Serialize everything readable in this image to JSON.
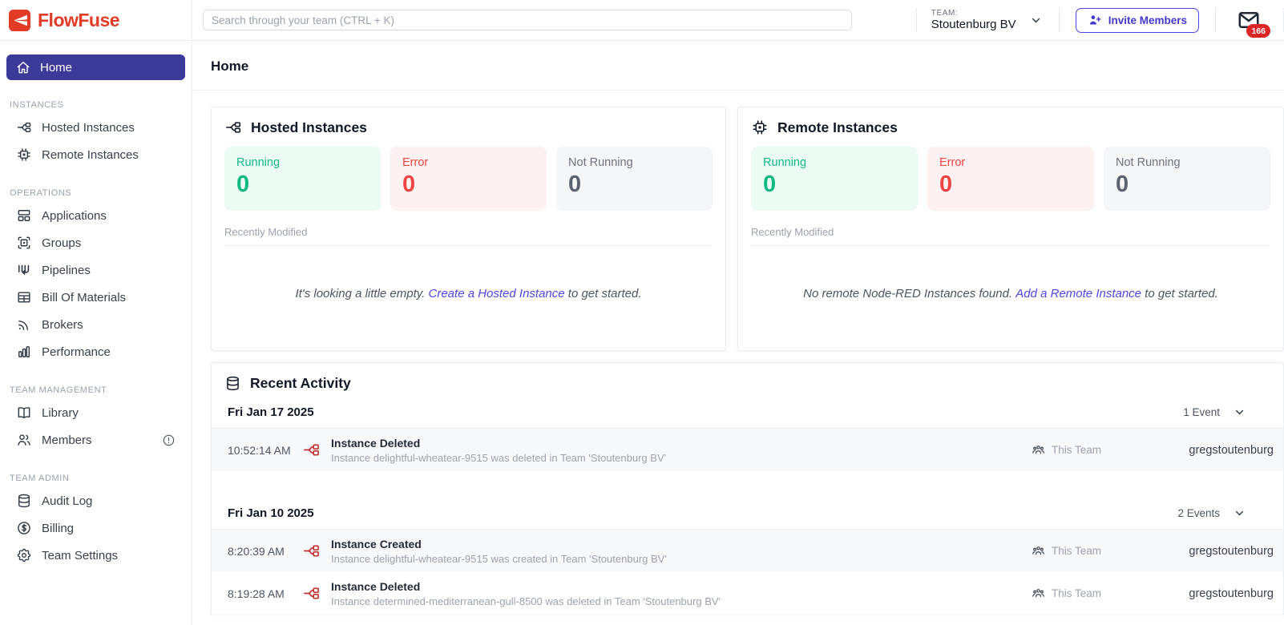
{
  "brand": {
    "name": "FlowFuse"
  },
  "colors": {
    "brand": "#E23C28",
    "accent": "#4F46E5",
    "nav_active_bg": "#3B3A9A",
    "badge_red": "#DC2626",
    "running_fg": "#10B981",
    "running_bg": "#ECFBF4",
    "error_fg": "#EF4444",
    "error_bg": "#FDF1F1",
    "neutral_fg": "#5A6372",
    "neutral_bg": "#F5F6F8"
  },
  "header": {
    "search_placeholder": "Search through your team (CTRL + K)",
    "team_label": "TEAM:",
    "team_name": "Stoutenburg BV",
    "invite_button": "Invite Members",
    "notification_count": "166"
  },
  "sidebar": {
    "home": {
      "label": "Home"
    },
    "sections": [
      {
        "title": "INSTANCES",
        "items": [
          {
            "label": "Hosted Instances"
          },
          {
            "label": "Remote Instances"
          }
        ]
      },
      {
        "title": "OPERATIONS",
        "items": [
          {
            "label": "Applications"
          },
          {
            "label": "Groups"
          },
          {
            "label": "Pipelines"
          },
          {
            "label": "Bill Of Materials"
          },
          {
            "label": "Brokers"
          },
          {
            "label": "Performance"
          }
        ]
      },
      {
        "title": "TEAM MANAGEMENT",
        "items": [
          {
            "label": "Library"
          },
          {
            "label": "Members",
            "alert": true
          }
        ]
      },
      {
        "title": "TEAM ADMIN",
        "items": [
          {
            "label": "Audit Log"
          },
          {
            "label": "Billing"
          },
          {
            "label": "Team Settings"
          }
        ]
      }
    ]
  },
  "page": {
    "title": "Home"
  },
  "cards": {
    "hosted": {
      "title": "Hosted Instances",
      "stats": [
        {
          "label": "Running",
          "value": "0"
        },
        {
          "label": "Error",
          "value": "0"
        },
        {
          "label": "Not Running",
          "value": "0"
        }
      ],
      "recently_modified": "Recently Modified",
      "empty_prefix": "It's looking a little empty. ",
      "empty_link": "Create a Hosted Instance",
      "empty_suffix": " to get started."
    },
    "remote": {
      "title": "Remote Instances",
      "stats": [
        {
          "label": "Running",
          "value": "0"
        },
        {
          "label": "Error",
          "value": "0"
        },
        {
          "label": "Not Running",
          "value": "0"
        }
      ],
      "recently_modified": "Recently Modified",
      "empty_prefix": "No remote Node-RED Instances found. ",
      "empty_link": "Add a Remote Instance",
      "empty_suffix": " to get started."
    }
  },
  "activity": {
    "title": "Recent Activity",
    "groups": [
      {
        "date": "Fri Jan 17 2025",
        "count": "1 Event",
        "events": [
          {
            "time": "10:52:14 AM",
            "title": "Instance Deleted",
            "description": "Instance delightful-wheatear-9515 was deleted in Team 'Stoutenburg BV'",
            "scope": "This Team",
            "user": "gregstoutenburg"
          }
        ]
      },
      {
        "date": "Fri Jan 10 2025",
        "count": "2 Events",
        "events": [
          {
            "time": "8:20:39 AM",
            "title": "Instance Created",
            "description": "Instance delightful-wheatear-9515 was created in Team 'Stoutenburg BV'",
            "scope": "This Team",
            "user": "gregstoutenburg"
          },
          {
            "time": "8:19:28 AM",
            "title": "Instance Deleted",
            "description": "Instance determined-mediterranean-gull-8500 was deleted in Team 'Stoutenburg BV'",
            "scope": "This Team",
            "user": "gregstoutenburg"
          }
        ]
      }
    ]
  }
}
